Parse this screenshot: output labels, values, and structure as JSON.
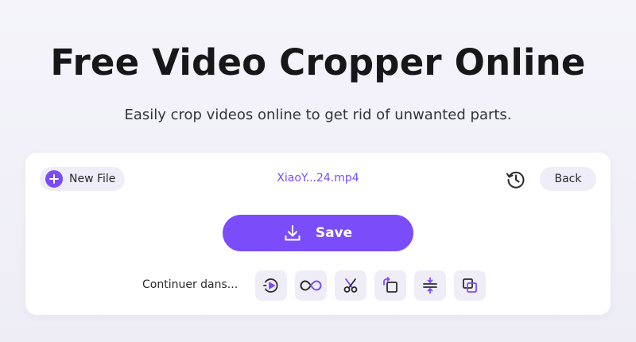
{
  "header": {
    "title": "Free Video Cropper Online",
    "subtitle": "Easily crop videos online to get rid of unwanted parts."
  },
  "toolbar": {
    "new_file_label": "New File",
    "file_name": "XiaoY...24.mp4",
    "back_label": "Back"
  },
  "actions": {
    "save_label": "Save",
    "continue_label": "Continuer dans..."
  },
  "tools": [
    {
      "icon": "video-speed-icon"
    },
    {
      "icon": "loop-icon"
    },
    {
      "icon": "trim-scissors-icon"
    },
    {
      "icon": "rotate-icon"
    },
    {
      "icon": "merge-icon"
    },
    {
      "icon": "overlay-icon"
    }
  ],
  "colors": {
    "accent": "#7b4dfa",
    "pill_bg": "#efedf7",
    "page_bg": "#f1f0f8",
    "card_bg": "#ffffff"
  }
}
